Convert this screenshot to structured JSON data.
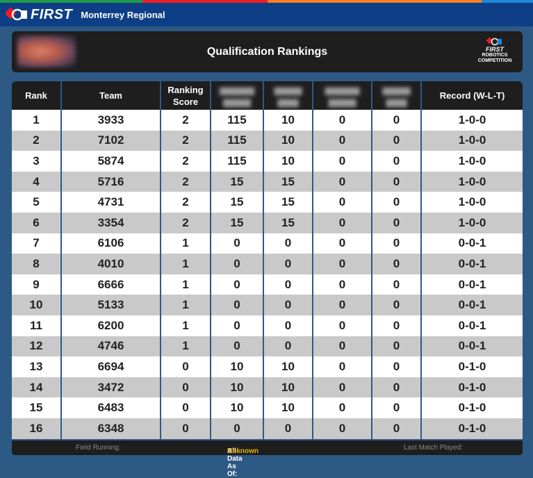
{
  "brand": {
    "logo_text": "FIRST",
    "event_name": "Monterrey Regional",
    "stripe_colors": [
      "#1e9a48",
      "#ed1c24",
      "#f57e25",
      "#1e88d6"
    ]
  },
  "header": {
    "title": "Qualification Rankings",
    "frc_logo": {
      "first": "FIRST",
      "line1": "ROBOTICS",
      "line2": "COMPETITION"
    }
  },
  "table": {
    "columns": [
      "Rank",
      "Team",
      "Ranking Score",
      "",
      "",
      "",
      "",
      "Record (W-L-T)"
    ],
    "column_header_lines": [
      [
        "Rank"
      ],
      [
        "Team"
      ],
      [
        "Ranking",
        "Score"
      ],
      [
        ""
      ],
      [
        ""
      ],
      [
        ""
      ],
      [
        ""
      ],
      [
        "Record (W-L-T)"
      ]
    ],
    "rows": [
      [
        "1",
        "3933",
        "2",
        "115",
        "10",
        "0",
        "0",
        "1-0-0"
      ],
      [
        "2",
        "7102",
        "2",
        "115",
        "10",
        "0",
        "0",
        "1-0-0"
      ],
      [
        "3",
        "5874",
        "2",
        "115",
        "10",
        "0",
        "0",
        "1-0-0"
      ],
      [
        "4",
        "5716",
        "2",
        "15",
        "15",
        "0",
        "0",
        "1-0-0"
      ],
      [
        "5",
        "4731",
        "2",
        "15",
        "15",
        "0",
        "0",
        "1-0-0"
      ],
      [
        "6",
        "3354",
        "2",
        "15",
        "15",
        "0",
        "0",
        "1-0-0"
      ],
      [
        "7",
        "6106",
        "1",
        "0",
        "0",
        "0",
        "0",
        "0-0-1"
      ],
      [
        "8",
        "4010",
        "1",
        "0",
        "0",
        "0",
        "0",
        "0-0-1"
      ],
      [
        "9",
        "6666",
        "1",
        "0",
        "0",
        "0",
        "0",
        "0-0-1"
      ],
      [
        "10",
        "5133",
        "1",
        "0",
        "0",
        "0",
        "0",
        "0-0-1"
      ],
      [
        "11",
        "6200",
        "1",
        "0",
        "0",
        "0",
        "0",
        "0-0-1"
      ],
      [
        "12",
        "4746",
        "1",
        "0",
        "0",
        "0",
        "0",
        "0-0-1"
      ],
      [
        "13",
        "6694",
        "0",
        "10",
        "10",
        "0",
        "0",
        "0-1-0"
      ],
      [
        "14",
        "3472",
        "0",
        "10",
        "10",
        "0",
        "0",
        "0-1-0"
      ],
      [
        "15",
        "6483",
        "0",
        "10",
        "10",
        "0",
        "0",
        "0-1-0"
      ],
      [
        "16",
        "6348",
        "0",
        "0",
        "0",
        "0",
        "0",
        "0-1-0"
      ]
    ]
  },
  "footer": {
    "field_running_label": "Field Running:",
    "all_data_label": "All Data As Of:",
    "all_data_value": "Unknown",
    "last_match_label": "Last Match Played:"
  }
}
